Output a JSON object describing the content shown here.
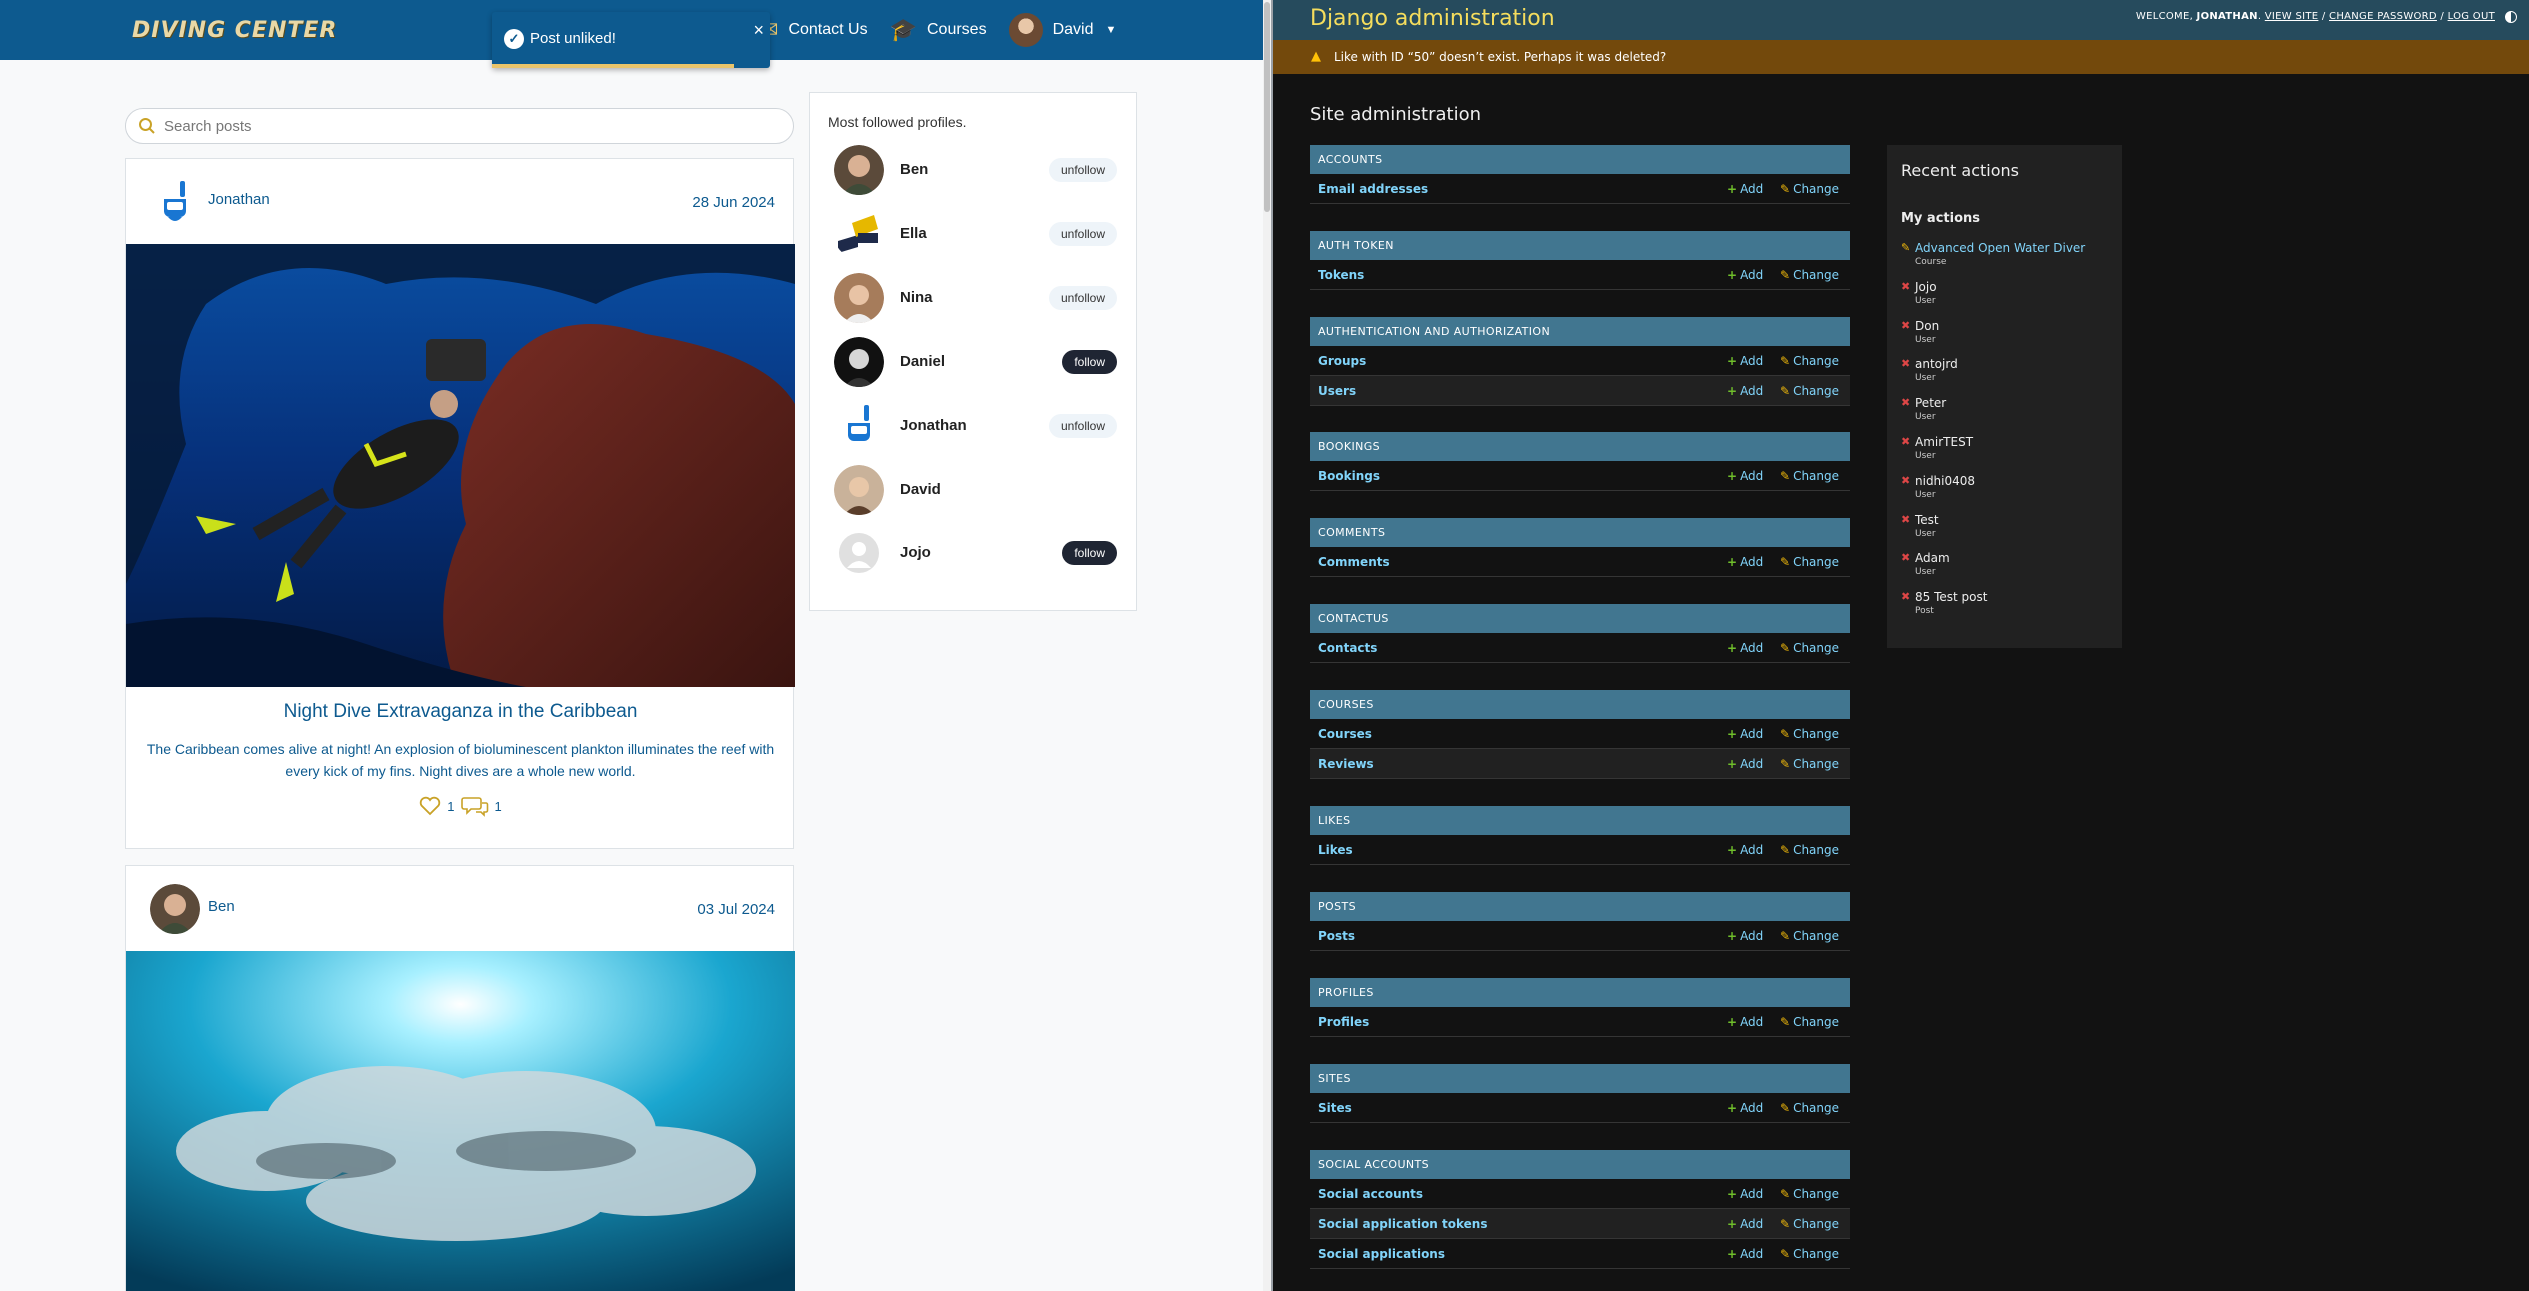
{
  "app": {
    "brand": "DIVING CENTER",
    "nav": {
      "contact_label": "Contact Us",
      "courses_label": "Courses",
      "user_label": "David"
    }
  },
  "toast": {
    "message": "Post unliked!",
    "close_glyph": "×",
    "check_glyph": "✓"
  },
  "search": {
    "placeholder": "Search posts"
  },
  "posts": [
    {
      "author": "Jonathan",
      "date": "28 Jun 2024",
      "title": "Night Dive Extravaganza in the Caribbean",
      "body": "The Caribbean comes alive at night! An explosion of bioluminescent plankton illuminates the reef with every kick of my fins. Night dives are a whole new world.",
      "likes": "1",
      "comments": "1"
    },
    {
      "author": "Ben",
      "date": "03 Jul 2024"
    }
  ],
  "profiles": {
    "title": "Most followed profiles.",
    "items": [
      {
        "name": "Ben",
        "action": "unfollow"
      },
      {
        "name": "Ella",
        "action": "unfollow"
      },
      {
        "name": "Nina",
        "action": "unfollow"
      },
      {
        "name": "Daniel",
        "action": "follow"
      },
      {
        "name": "Jonathan",
        "action": "unfollow"
      },
      {
        "name": "David",
        "action": ""
      },
      {
        "name": "Jojo",
        "action": "follow"
      }
    ]
  },
  "admin": {
    "brand": "Django administration",
    "welcome": "WELCOME,",
    "user": "JONATHAN",
    "view_site": "VIEW SITE",
    "change_password": "CHANGE PASSWORD",
    "logout": "LOG OUT",
    "sep": "/",
    "warning": "Like with ID “50” doesn’t exist. Perhaps it was deleted?",
    "site_title": "Site administration",
    "add_label": "Add",
    "change_label": "Change",
    "modules": [
      {
        "caption": "ACCOUNTS",
        "rows": [
          "Email addresses"
        ]
      },
      {
        "caption": "AUTH TOKEN",
        "rows": [
          "Tokens"
        ]
      },
      {
        "caption": "AUTHENTICATION AND AUTHORIZATION",
        "rows": [
          "Groups",
          "Users"
        ]
      },
      {
        "caption": "BOOKINGS",
        "rows": [
          "Bookings"
        ]
      },
      {
        "caption": "COMMENTS",
        "rows": [
          "Comments"
        ]
      },
      {
        "caption": "CONTACTUS",
        "rows": [
          "Contacts"
        ]
      },
      {
        "caption": "COURSES",
        "rows": [
          "Courses",
          "Reviews"
        ]
      },
      {
        "caption": "LIKES",
        "rows": [
          "Likes"
        ]
      },
      {
        "caption": "POSTS",
        "rows": [
          "Posts"
        ]
      },
      {
        "caption": "PROFILES",
        "rows": [
          "Profiles"
        ]
      },
      {
        "caption": "SITES",
        "rows": [
          "Sites"
        ]
      },
      {
        "caption": "SOCIAL ACCOUNTS",
        "rows": [
          "Social accounts",
          "Social application tokens",
          "Social applications"
        ]
      }
    ],
    "recent": {
      "title": "Recent actions",
      "subtitle": "My actions",
      "items": [
        {
          "name": "Advanced Open Water Diver",
          "type": "Course",
          "kind": "edit"
        },
        {
          "name": "Jojo",
          "type": "User",
          "kind": "delete"
        },
        {
          "name": "Don",
          "type": "User",
          "kind": "delete"
        },
        {
          "name": "antojrd",
          "type": "User",
          "kind": "delete"
        },
        {
          "name": "Peter",
          "type": "User",
          "kind": "delete"
        },
        {
          "name": "AmirTEST",
          "type": "User",
          "kind": "delete"
        },
        {
          "name": "nidhi0408",
          "type": "User",
          "kind": "delete"
        },
        {
          "name": "Test",
          "type": "User",
          "kind": "delete"
        },
        {
          "name": "Adam",
          "type": "User",
          "kind": "delete"
        },
        {
          "name": "85 Test post",
          "type": "Post",
          "kind": "delete"
        }
      ]
    }
  }
}
